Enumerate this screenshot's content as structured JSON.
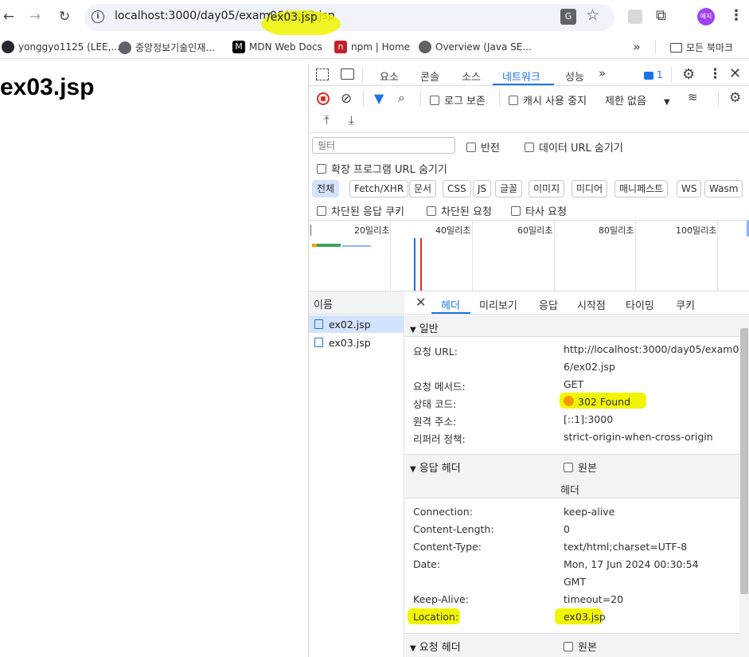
{
  "browser": {
    "url": "localhost:3000/day05/exam06/ex03.jsp",
    "profile_initials": "예지"
  },
  "bookmarks": {
    "items": [
      {
        "label": "yonggyo1125 (LEE,...",
        "icon": "github-icon"
      },
      {
        "label": "중앙정보기술인재...",
        "icon": "globe-icon"
      },
      {
        "label": "MDN Web Docs",
        "icon": "mdn-icon"
      },
      {
        "label": "npm | Home",
        "icon": "npm-icon"
      },
      {
        "label": "Overview (Java SE...",
        "icon": "globe-icon"
      }
    ],
    "overflow": "»",
    "folder_label": "모든 북마크"
  },
  "page": {
    "heading": "ex03.jsp"
  },
  "devtools": {
    "tabs": [
      "요소",
      "콘솔",
      "소스",
      "네트워크",
      "성능"
    ],
    "active_tab": "네트워크",
    "more": "»",
    "message_count": "1",
    "toolbar": {
      "preserve_log": "로그 보존",
      "disable_cache": "캐시 사용 중지",
      "throttling": "제한 없음"
    },
    "filter": {
      "placeholder": "필터",
      "invert": "반전",
      "hide_data_urls": "데이터 URL 숨기기",
      "hide_extension_urls": "확장 프로그램 URL 숨기기"
    },
    "type_chips": [
      "전체",
      "Fetch/XHR",
      "문서",
      "CSS",
      "JS",
      "글꼴",
      "이미지",
      "미디어",
      "매니페스트",
      "WS",
      "Wasm"
    ],
    "blocked": {
      "blocked_cookies": "차단된 응답 쿠키",
      "blocked_requests": "차단된 요청",
      "third_party": "타사 요청"
    },
    "timeline_ticks": [
      "20밀리초",
      "40밀리초",
      "60밀리초",
      "80밀리초",
      "100밀리초"
    ],
    "requests": {
      "column_name": "이름",
      "rows": [
        "ex02.jsp",
        "ex03.jsp"
      ]
    },
    "detail_tabs": [
      "헤더",
      "미리보기",
      "응답",
      "시작점",
      "타이밍",
      "쿠키"
    ],
    "active_detail_tab": "헤더",
    "general": {
      "title": "일반",
      "rows": [
        {
          "key": "요청 URL:",
          "value": "http://localhost:3000/day05/exam0"
        },
        {
          "key": "",
          "value": "6/ex02.jsp"
        },
        {
          "key": "요청 메서드:",
          "value": "GET"
        },
        {
          "key": "상태 코드:",
          "value": "302 Found"
        },
        {
          "key": "원격 주소:",
          "value": "[::1]:3000"
        },
        {
          "key": "리퍼러 정책:",
          "value": "strict-origin-when-cross-origin"
        }
      ],
      "status_color": "#f29900"
    },
    "response_headers": {
      "title": "응답 헤더",
      "raw_label": "원본",
      "sub_label": "헤더",
      "rows": [
        {
          "key": "Connection:",
          "value": "keep-alive"
        },
        {
          "key": "Content-Length:",
          "value": "0"
        },
        {
          "key": "Content-Type:",
          "value": "text/html;charset=UTF-8"
        },
        {
          "key": "Date:",
          "value": "Mon, 17 Jun 2024 00:30:54"
        },
        {
          "key": "",
          "value": "GMT"
        },
        {
          "key": "Keep-Alive:",
          "value": "timeout=20"
        },
        {
          "key": "Location:",
          "value": "ex03.jsp"
        }
      ]
    },
    "request_headers": {
      "title": "요청 헤더",
      "raw_label": "원본"
    },
    "accent_color": "#1a73e8"
  }
}
